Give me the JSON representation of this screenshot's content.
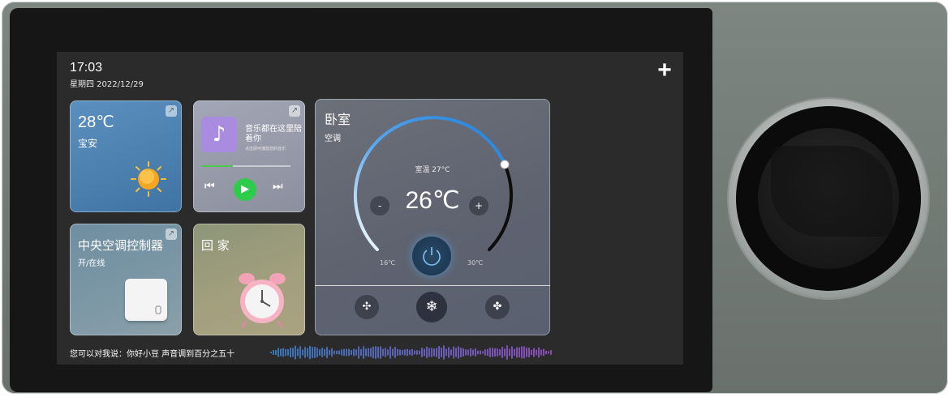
{
  "status": {
    "time": "17:03",
    "date": "星期四 2022/12/29"
  },
  "header": {
    "add_symbol": "+"
  },
  "weather": {
    "temperature": "28℃",
    "location": "宝安"
  },
  "music": {
    "title": "音乐都在这里陪着你",
    "subtitle": "点击即可播放您的音乐",
    "progress": 0.35
  },
  "central_ac": {
    "title": "中央空调控制器",
    "status": "开/在线"
  },
  "home_scene": {
    "title": "回 家"
  },
  "bedroom": {
    "room": "卧室",
    "device": "空调",
    "indoor_temp": "室温 27°C",
    "setpoint": "26℃",
    "min": "16℃",
    "max": "30℃",
    "minus": "-",
    "plus": "+"
  },
  "voice": {
    "prompt": "您可以对我说：你好小豆 声音调到百分之五十"
  },
  "colors": {
    "accent_green": "#2dcc4a",
    "gauge_blue": "#2f8fe0"
  }
}
